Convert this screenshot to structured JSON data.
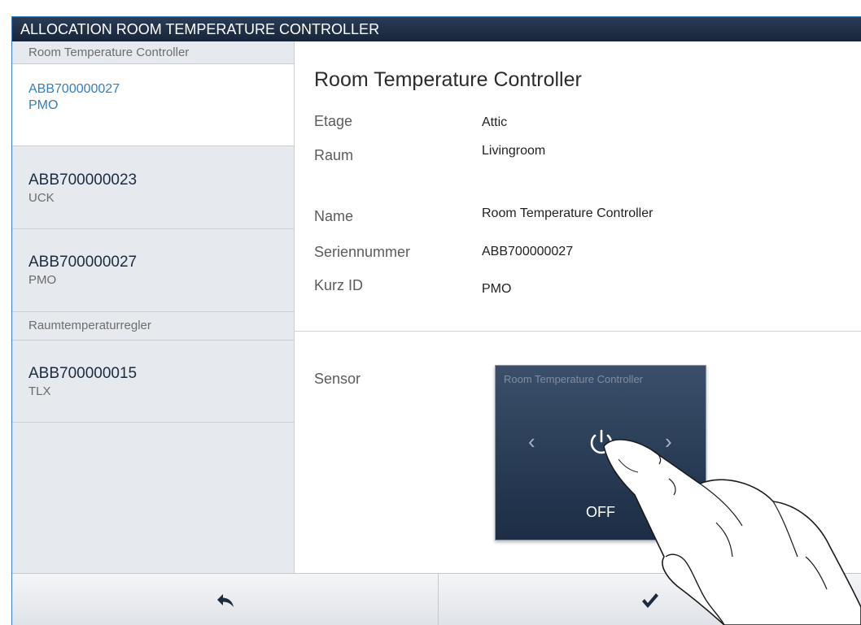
{
  "window": {
    "title": "ALLOCATION ROOM TEMPERATURE CONTROLLER"
  },
  "sidebar": {
    "groups": [
      {
        "header": "Room Temperature Controller",
        "items": [
          {
            "serial": "ABB700000027",
            "short_id": "PMO",
            "selected": true
          },
          {
            "serial": "ABB700000023",
            "short_id": "UCK",
            "selected": false
          },
          {
            "serial": "ABB700000027",
            "short_id": "PMO",
            "selected": false
          }
        ]
      },
      {
        "header": "Raumtemperaturregler",
        "items": [
          {
            "serial": "ABB700000015",
            "short_id": "TLX",
            "selected": false
          }
        ]
      }
    ]
  },
  "detail": {
    "title": "Room Temperature Controller",
    "fields": [
      {
        "label": "Etage",
        "value": "Attic"
      },
      {
        "label": "Raum",
        "value": "Livingroom"
      },
      {
        "label": "Name",
        "value": "Room Temperature Controller"
      },
      {
        "label": "Seriennummer",
        "value": "ABB700000027"
      },
      {
        "label": "Kurz ID",
        "value": "PMO"
      }
    ],
    "sensor": {
      "label": "Sensor",
      "panel_title": "Room Temperature Controller",
      "state": "OFF",
      "icons": [
        "chevron-left-icon",
        "power-icon",
        "chevron-right-icon"
      ]
    }
  },
  "footer": {
    "buttons": [
      {
        "icon": "back-arrow-icon"
      },
      {
        "icon": "checkmark-icon"
      }
    ]
  },
  "colors": {
    "titlebar": "#1c2b42",
    "sidebar_bg": "#e6e9ee",
    "selected_text": "#2f7fc0",
    "sensor_panel": "#24364f"
  }
}
